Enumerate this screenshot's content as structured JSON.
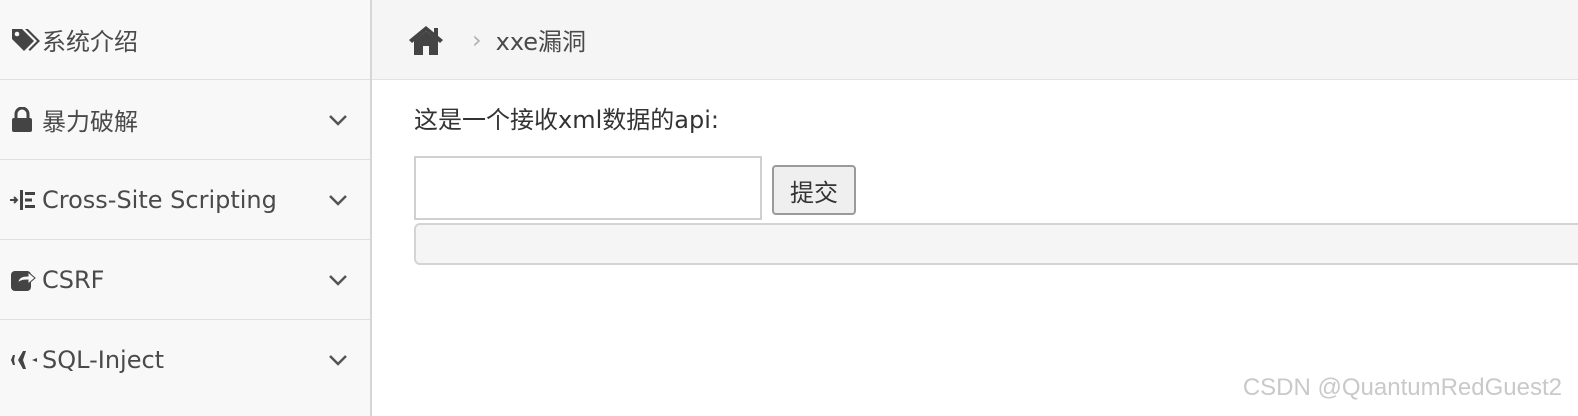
{
  "sidebar": {
    "items": [
      {
        "label": "系统介绍",
        "icon": "tags-icon",
        "has_submenu": false
      },
      {
        "label": "暴力破解",
        "icon": "lock-icon",
        "has_submenu": true
      },
      {
        "label": "Cross-Site Scripting",
        "icon": "indent-icon",
        "has_submenu": true
      },
      {
        "label": "CSRF",
        "icon": "share-square-icon",
        "has_submenu": true
      },
      {
        "label": "SQL-Inject",
        "icon": "plane-icon",
        "has_submenu": true
      }
    ]
  },
  "breadcrumb": {
    "home_icon": "home-icon",
    "separator": "›",
    "current": "xxe漏洞"
  },
  "main": {
    "intro_text": "这是一个接收xml数据的api:",
    "xml_input": {
      "value": "",
      "placeholder": ""
    },
    "submit_label": "提交",
    "result_text": ""
  },
  "watermark": "CSDN @QuantumRedGuest2",
  "colors": {
    "sidebar_bg": "#f8f8f8",
    "breadcrumb_bg": "#f5f5f5",
    "text": "#4a4a4a"
  }
}
